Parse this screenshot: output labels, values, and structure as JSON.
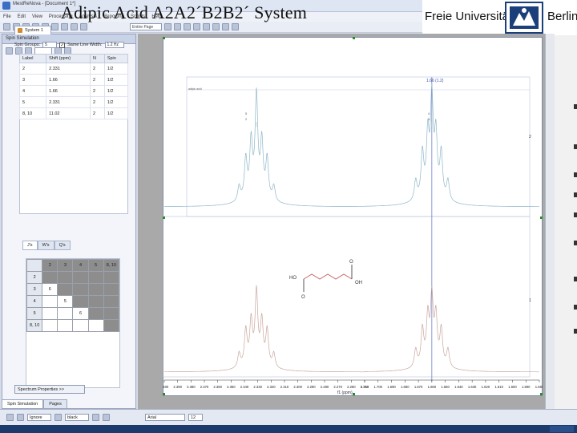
{
  "window": {
    "title": "MestReNova - [Document 1*]"
  },
  "overlay_title": "Adipic Acid A2A2´B2B2´ System",
  "menu": [
    "File",
    "Edit",
    "View",
    "Processing",
    "Analysis",
    "Reporting",
    "Scripts",
    "Help"
  ],
  "toolbar": {
    "page_combo": "Entire Page"
  },
  "logo": {
    "name": "Freie Universität",
    "city": "Berlin"
  },
  "side_panel": {
    "header": "Spin Simulation",
    "system_tab": "System 1",
    "spins_label": "Spin Groups:",
    "spins_value": "5",
    "same_width_label": "Same Line Width:",
    "same_width_value": "1.2 Hz",
    "same_width_checked": "✓",
    "table": {
      "columns": [
        "Label",
        "Shift (ppm)",
        "N",
        "Spin"
      ],
      "rows": [
        [
          "2",
          "2.331",
          "2",
          "1/2"
        ],
        [
          "3",
          "1.66",
          "2",
          "1/2"
        ],
        [
          "4",
          "1.66",
          "2",
          "1/2"
        ],
        [
          "5",
          "2.331",
          "2",
          "1/2"
        ],
        [
          "8, 10",
          "11.02",
          "2",
          "1/2"
        ]
      ]
    },
    "coupling_tabs": [
      "J's",
      "W's",
      "Q's"
    ],
    "coupling_grid": {
      "columns": [
        "",
        "2",
        "3",
        "4",
        "5",
        "8, 10"
      ],
      "rows": [
        [
          "2",
          "",
          "",
          "",
          "",
          ""
        ],
        [
          "3",
          "6",
          "",
          "",
          "",
          ""
        ],
        [
          "4",
          "",
          "5",
          "",
          "",
          ""
        ],
        [
          "5",
          "",
          "",
          "6",
          "",
          ""
        ],
        [
          "8, 10",
          "",
          "",
          "",
          "",
          ""
        ]
      ]
    },
    "spectrum_properties": "Spectrum Properties >>",
    "bottom_tabs": [
      "Spin Simulation",
      "Pages"
    ]
  },
  "document": {
    "top_label": "adipic acid",
    "cursor_readout": "1.66 (1.2)",
    "trace_label_top": "2",
    "trace_label_bottom": "1",
    "peak_label_left_top": "5",
    "peak_label_left_bottom": "2",
    "peak_label_right_top": "4",
    "peak_label_right_bottom": "3",
    "molecule": {
      "ho": "HO",
      "oh": "OH",
      "o_top": "O",
      "o_bottom": "O"
    },
    "axis_title": "f1 (ppm)"
  },
  "chart_data": {
    "type": "line",
    "title": "",
    "xlabel": "f1 (ppm)",
    "ylabel": "",
    "x_axis_ticks": [
      "2.400",
      "2.390",
      "2.380",
      "2.370",
      "2.360",
      "2.350",
      "2.340",
      "2.330",
      "2.320",
      "2.310",
      "2.300",
      "2.290",
      "2.280",
      "2.270",
      "2.260",
      "2.250",
      "1.710",
      "1.700",
      "1.690",
      "1.680",
      "1.670",
      "1.660",
      "1.650",
      "1.640",
      "1.630",
      "1.620",
      "1.610",
      "1.600",
      "1.590",
      "1.580"
    ],
    "x_axis_break": "between 2.250 and 1.710",
    "series": [
      {
        "name": "2",
        "peaks": [
          {
            "center": 2.331,
            "multiplet": [
              2.344,
              2.339,
              2.335,
              2.331,
              2.327,
              2.323,
              2.318
            ],
            "relative_heights": [
              0.15,
              0.4,
              0.55,
              1.0,
              0.55,
              0.4,
              0.15
            ]
          },
          {
            "center": 1.66,
            "multiplet": [
              1.672,
              1.667,
              1.663,
              1.66,
              1.657,
              1.653,
              1.648
            ],
            "relative_heights": [
              0.2,
              0.45,
              0.6,
              0.95,
              0.6,
              0.45,
              0.2
            ]
          }
        ]
      },
      {
        "name": "1",
        "peaks": [
          {
            "center": 2.331,
            "multiplet": [
              2.344,
              2.339,
              2.335,
              2.331,
              2.327,
              2.323,
              2.318
            ],
            "relative_heights": [
              0.2,
              0.5,
              0.6,
              1.0,
              0.6,
              0.5,
              0.2
            ]
          },
          {
            "center": 1.66,
            "multiplet": [
              1.672,
              1.667,
              1.663,
              1.66,
              1.657,
              1.653,
              1.648
            ],
            "relative_heights": [
              0.25,
              0.5,
              0.65,
              0.9,
              0.65,
              0.5,
              0.25
            ]
          }
        ]
      }
    ],
    "colors": {
      "top_trace": "#8fb8c9",
      "bottom_trace": "#c9a7a0",
      "cursor": "#6b7fc9"
    },
    "grid": false
  },
  "statusbar": {
    "combo1": "Ignore",
    "combo2": "black",
    "combo3": "Arial",
    "combo4": "12"
  }
}
